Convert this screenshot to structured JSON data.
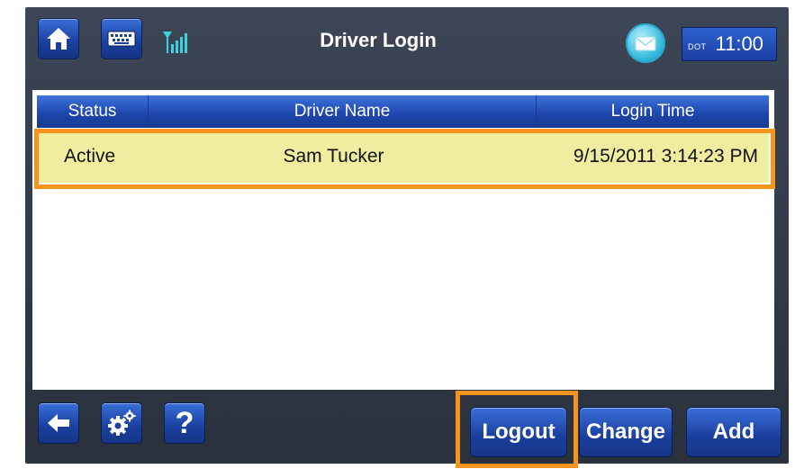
{
  "header": {
    "title": "Driver Login",
    "dot_label": "DOT",
    "time": "11:00",
    "icons": [
      "home-icon",
      "keyboard-icon",
      "signal-strength-icon",
      "mail-icon"
    ]
  },
  "table": {
    "columns": [
      "Status",
      "Driver Name",
      "Login Time"
    ],
    "rows": [
      {
        "status": "Active",
        "driver_name": "Sam Tucker",
        "login_time": "9/15/2011 3:14:23 PM"
      }
    ]
  },
  "footer": {
    "help_label": "?",
    "logout_label": "Logout",
    "change_label": "Change",
    "add_label": "Add",
    "icons": [
      "back-arrow-icon",
      "settings-icon"
    ]
  },
  "colors": {
    "accent_blue": "#1f49b0",
    "highlight_orange": "#f7941d",
    "selected_row": "#f1eda0"
  }
}
